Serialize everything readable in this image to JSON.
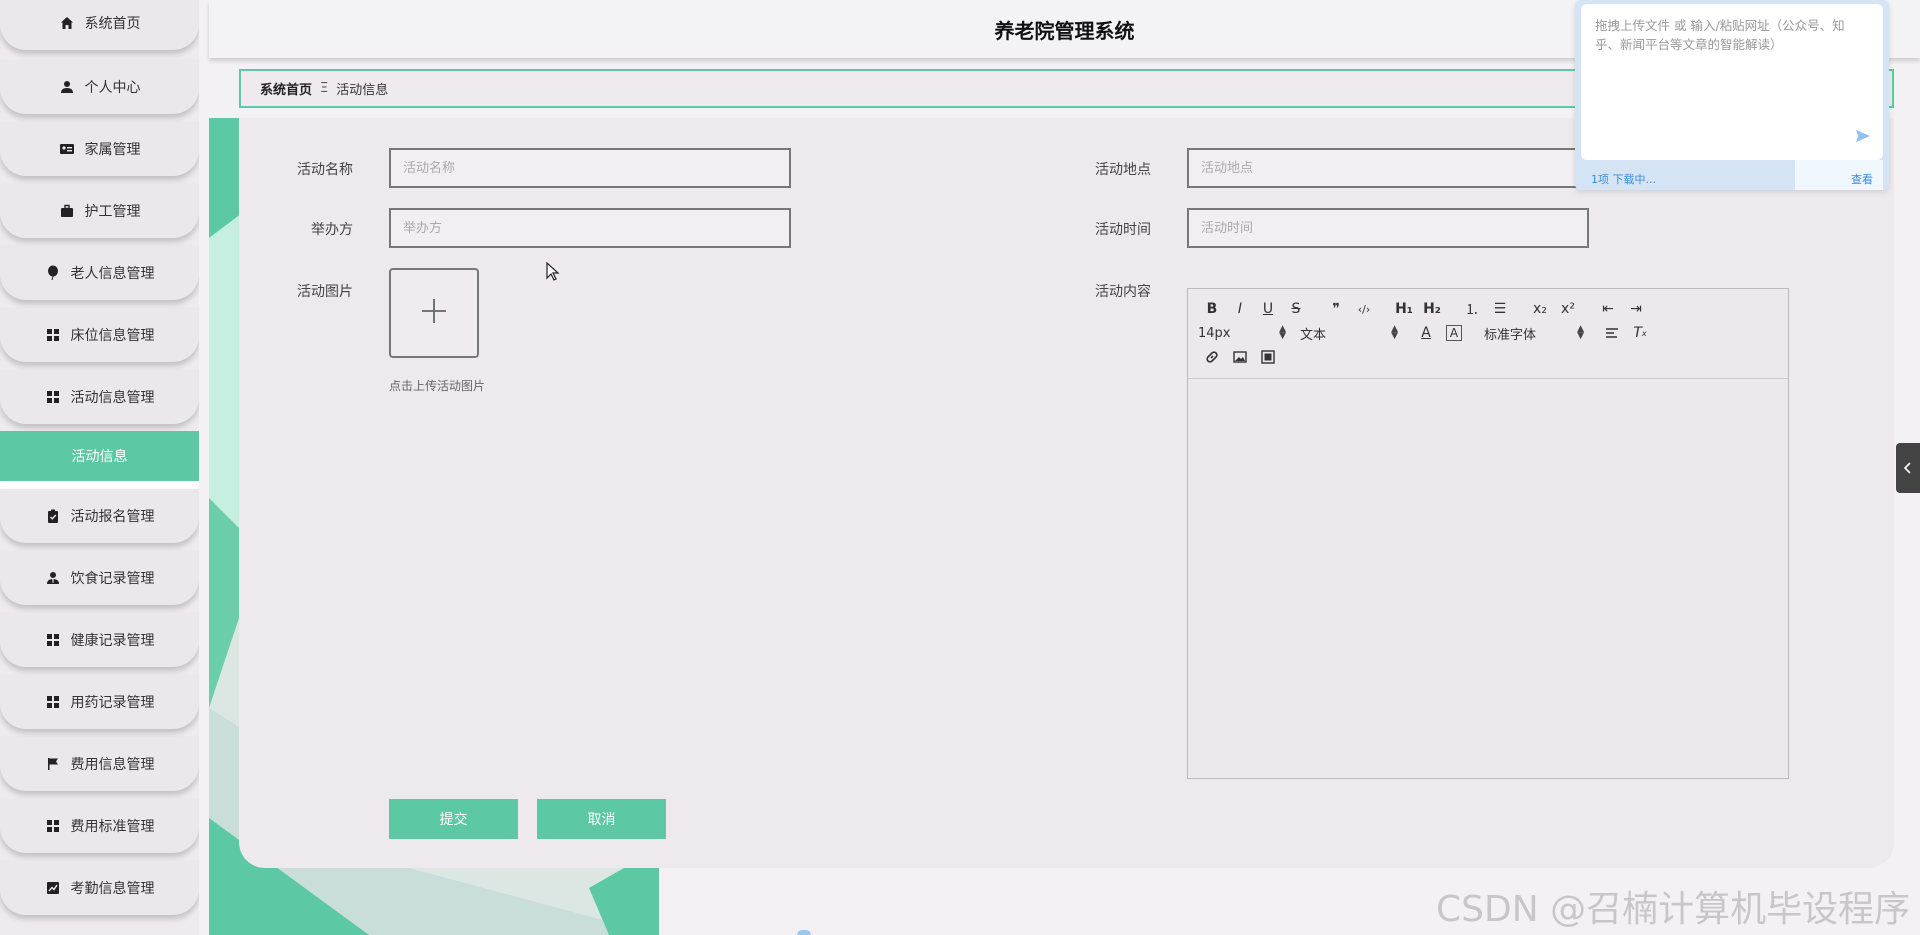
{
  "app": {
    "title": "养老院管理系统"
  },
  "sidebar": {
    "items": [
      {
        "label": "系统首页",
        "icon": "home-icon"
      },
      {
        "label": "个人中心",
        "icon": "user-icon"
      },
      {
        "label": "家属管理",
        "icon": "id-card-icon"
      },
      {
        "label": "护工管理",
        "icon": "briefcase-icon"
      },
      {
        "label": "老人信息管理",
        "icon": "balloon-icon"
      },
      {
        "label": "床位信息管理",
        "icon": "grid-icon"
      },
      {
        "label": "活动信息管理",
        "icon": "grid-icon"
      },
      {
        "label": "活动报名管理",
        "icon": "clipboard-check-icon"
      },
      {
        "label": "饮食记录管理",
        "icon": "user-tie-icon"
      },
      {
        "label": "健康记录管理",
        "icon": "grid-icon"
      },
      {
        "label": "用药记录管理",
        "icon": "grid-icon"
      },
      {
        "label": "费用信息管理",
        "icon": "flag-icon"
      },
      {
        "label": "费用标准管理",
        "icon": "grid-icon"
      },
      {
        "label": "考勤信息管理",
        "icon": "chart-line-icon"
      }
    ],
    "active_sub": "活动信息"
  },
  "breadcrumb": {
    "home": "系统首页",
    "separator": "Ξ",
    "current": "活动信息"
  },
  "form": {
    "name": {
      "label": "活动名称",
      "placeholder": "活动名称"
    },
    "location": {
      "label": "活动地点",
      "placeholder": "活动地点"
    },
    "organizer": {
      "label": "举办方",
      "placeholder": "举办方"
    },
    "time": {
      "label": "活动时间",
      "placeholder": "活动时间"
    },
    "image": {
      "label": "活动图片",
      "hint": "点击上传活动图片"
    },
    "content": {
      "label": "活动内容"
    },
    "submit": "提交",
    "cancel": "取消"
  },
  "editor": {
    "size_select": "14px",
    "header_select": "文本",
    "font_select": "标准字体",
    "toolbar_row1": [
      {
        "name": "bold-icon",
        "glyph": "B"
      },
      {
        "name": "italic-icon",
        "glyph": "I"
      },
      {
        "name": "underline-icon",
        "glyph": "U"
      },
      {
        "name": "strike-icon",
        "glyph": "S"
      },
      {
        "name": "blockquote-icon",
        "glyph": "❞"
      },
      {
        "name": "code-block-icon",
        "glyph": "‹/›"
      },
      {
        "name": "heading-1-icon",
        "glyph": "H₁"
      },
      {
        "name": "heading-2-icon",
        "glyph": "H₂"
      },
      {
        "name": "ordered-list-icon",
        "glyph": "⒈"
      },
      {
        "name": "bullet-list-icon",
        "glyph": "☰"
      },
      {
        "name": "subscript-icon",
        "glyph": "x₂"
      },
      {
        "name": "superscript-icon",
        "glyph": "x²"
      },
      {
        "name": "outdent-icon",
        "glyph": "⇤"
      },
      {
        "name": "indent-icon",
        "glyph": "⇥"
      }
    ]
  },
  "popup": {
    "placeholder": "拖拽上传文件 或 输入/粘贴网址（公众号、知乎、新闻平台等文章的智能解读）",
    "status": "1项 下载中...",
    "view": "查看"
  },
  "watermark": "CSDN @召楠计算机毕设程序",
  "colors": {
    "accent": "#5cc8a4",
    "sidebar_bg": "#ebe8eb",
    "card_bg": "#ede9ed"
  }
}
